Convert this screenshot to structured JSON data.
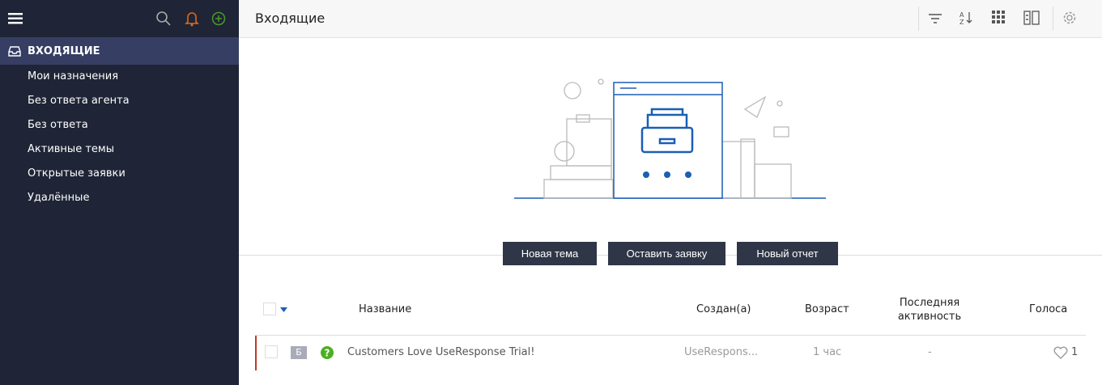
{
  "sidebar": {
    "active": "ВХОДЯЩИЕ",
    "items": [
      {
        "label": "Мои назначения"
      },
      {
        "label": "Без ответа агента"
      },
      {
        "label": "Без ответа"
      },
      {
        "label": "Активные темы"
      },
      {
        "label": "Открытые заявки"
      },
      {
        "label": "Удалённые"
      }
    ]
  },
  "header": {
    "title": "Входящие"
  },
  "actions": {
    "new_topic": "Новая тема",
    "leave_ticket": "Оставить заявку",
    "new_report": "Новый отчет"
  },
  "table": {
    "columns": {
      "name": "Название",
      "created": "Создан(а)",
      "age": "Возраст",
      "activity_line1": "Последняя",
      "activity_line2": "активность",
      "votes": "Голоса"
    },
    "rows": [
      {
        "badge": "Б",
        "title": "Customers Love UseResponse Trial!",
        "created": "UseRespons...",
        "age": "1 час",
        "activity": "-",
        "votes": "1"
      }
    ]
  },
  "colors": {
    "sidebar": "#1f2436",
    "active": "#363e63",
    "accent": "#1a5fb4",
    "button": "#2e3647"
  }
}
